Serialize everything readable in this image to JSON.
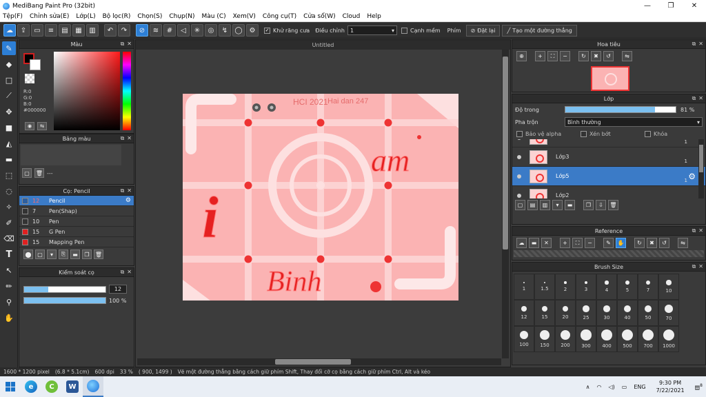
{
  "window": {
    "title": "MediBang Paint Pro (32bit)",
    "min_glyph": "—",
    "max_glyph": "❐",
    "close_glyph": "✕"
  },
  "menu": [
    "Tệp(F)",
    "Chỉnh sửa(E)",
    "Lớp(L)",
    "Bộ lọc(R)",
    "Chọn(S)",
    "Chụp(N)",
    "Màu (C)",
    "Xem(V)",
    "Công cụ(T)",
    "Cửa sổ(W)",
    "Cloud",
    "Help"
  ],
  "toolbar": {
    "antialias_label": "Khử răng cưa",
    "correction_label": "Điều chỉnh",
    "correction_value": "1",
    "soft_edge_label": "Cạnh mềm",
    "hotkey_label": "Phím",
    "reset_label": "Đặt lại",
    "line_label": "Tạo một đường thẳng"
  },
  "panels": {
    "color_title": "Màu",
    "rgb": [
      "R:0",
      "G:0",
      "B:0",
      "#000000"
    ],
    "swatch_title": "Bảng màu",
    "swatch_extra": "---",
    "brush_title": "Cọ: Pencil",
    "brush_control_title": "Kiểm soát cọ",
    "brush_size_value": "12",
    "brush_opacity_value": "100 %",
    "brush_size_fraction": 0.3,
    "brush_opacity_fraction": 1.0
  },
  "brushes": [
    {
      "size": "12",
      "name": "Pencil",
      "color": "#2d5fa0",
      "selected": true
    },
    {
      "size": "7",
      "name": "Pen(Shap)",
      "color": "#333333",
      "selected": false
    },
    {
      "size": "10",
      "name": "Pen",
      "color": "#333333",
      "selected": false
    },
    {
      "size": "15",
      "name": "G Pen",
      "color": "#e02020",
      "selected": false
    },
    {
      "size": "15",
      "name": "Mapping Pen",
      "color": "#e02020",
      "selected": false
    }
  ],
  "canvas": {
    "tab_title": "Untitled",
    "bg_color": "#fbb3b3",
    "text_tl": "HCI 2021",
    "text_tr": "Hai dan 247",
    "text_am": "am",
    "text_i": "i",
    "text_binh": "Binh"
  },
  "navigator": {
    "title": "Hoa tiêu"
  },
  "layer_panel": {
    "title": "Lớp",
    "opacity_label": "Độ trong",
    "opacity_value": "81 %",
    "opacity_fraction": 0.81,
    "blend_label": "Pha trộn",
    "blend_value": "Bình thường",
    "protect_alpha_label": "Bảo vệ alpha",
    "clip_label": "Xén bớt",
    "lock_label": "Khóa",
    "layers": [
      {
        "name": "",
        "num": "1",
        "selected": false
      },
      {
        "name": "Lớp3",
        "num": "1",
        "selected": false
      },
      {
        "name": "Lớp5",
        "num": "1",
        "selected": true
      },
      {
        "name": "Lớp2",
        "num": "",
        "selected": false
      }
    ]
  },
  "reference": {
    "title": "Reference"
  },
  "brush_size_panel": {
    "title": "Brush Size",
    "sizes": [
      "1",
      "1.5",
      "2",
      "3",
      "4",
      "5",
      "7",
      "10",
      "12",
      "15",
      "20",
      "25",
      "30",
      "40",
      "50",
      "70",
      "100",
      "150",
      "200",
      "300",
      "400",
      "500",
      "700",
      "1000"
    ]
  },
  "status": {
    "size": "1600 * 1200 pixel",
    "cm": "(6.8 * 5.1cm)",
    "dpi": "600 dpi",
    "zoom": "33 %",
    "coords": "( 900, 1499 )",
    "hint": "Vẽ một đường thẳng bằng cách giữ phím Shift, Thay đổi cỡ cọ bằng cách giữ phím Ctrl, Alt và kéo"
  },
  "taskbar": {
    "lang": "ENG",
    "time": "9:30 PM",
    "date": "7/22/2021",
    "notif_count": "8"
  },
  "colors": {
    "accent": "#2d7fd6",
    "brush_red": "#e02020"
  }
}
